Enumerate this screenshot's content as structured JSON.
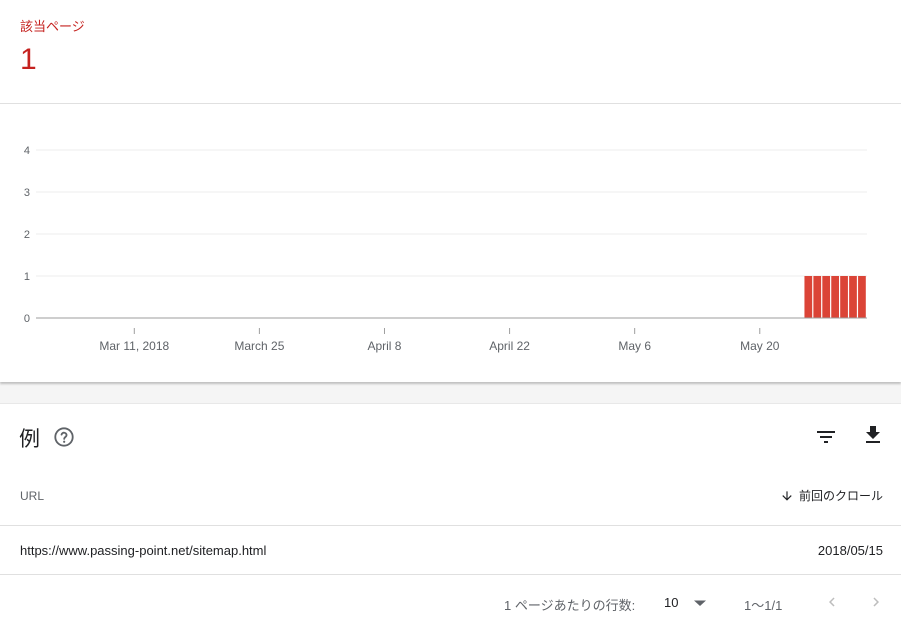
{
  "summary": {
    "label": "該当ページ",
    "value": "1",
    "accent_color": "#c5221f"
  },
  "chart_data": {
    "type": "bar",
    "y_ticks": [
      "0",
      "1",
      "2",
      "3",
      "4"
    ],
    "ylim": [
      0,
      4
    ],
    "x_tick_labels": [
      "Mar 11, 2018",
      "March 25",
      "April 8",
      "April 22",
      "May 6",
      "May 20"
    ],
    "x_tick_dates": [
      "2018-03-11",
      "2018-03-25",
      "2018-04-08",
      "2018-04-22",
      "2018-05-06",
      "2018-05-20"
    ],
    "xlim": [
      "2018-02-28",
      "2018-06-01"
    ],
    "bars": [
      {
        "date": "2018-05-25",
        "value": 1
      },
      {
        "date": "2018-05-26",
        "value": 1
      },
      {
        "date": "2018-05-27",
        "value": 1
      },
      {
        "date": "2018-05-28",
        "value": 1
      },
      {
        "date": "2018-05-29",
        "value": 1
      },
      {
        "date": "2018-05-30",
        "value": 1
      },
      {
        "date": "2018-05-31",
        "value": 1
      }
    ],
    "bar_color": "#db4437",
    "grid": true
  },
  "examples": {
    "title": "例",
    "help_icon": "help-circle-icon",
    "filter_icon": "filter-icon",
    "download_icon": "download-icon",
    "columns": {
      "url": "URL",
      "last_crawl": "前回のクロール",
      "sort_icon": "arrow-down-icon"
    },
    "rows": [
      {
        "url": "https://www.passing-point.net/sitemap.html",
        "date": "2018/05/15"
      }
    ]
  },
  "pager": {
    "rows_per_page_label": "1 ページあたりの行数:",
    "rows_per_page": "10",
    "range": "1〜1/1"
  }
}
